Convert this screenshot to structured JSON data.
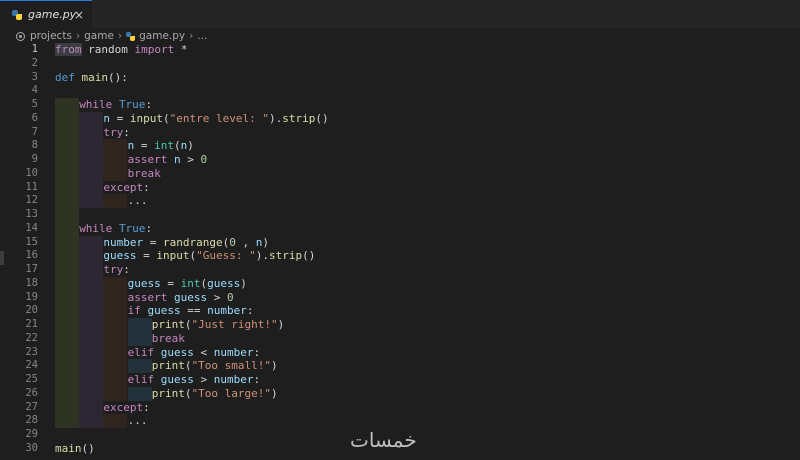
{
  "tab": {
    "filename": "game.py",
    "close_glyph": "×"
  },
  "breadcrumb": {
    "items": [
      "projects",
      "game",
      "game.py",
      "..."
    ]
  },
  "watermark": "خمسات",
  "colors": {
    "keyword_flow": "#c586c0",
    "keyword": "#569cd6",
    "function": "#dcdcaa",
    "string": "#ce9178",
    "number": "#b5cea8",
    "variable": "#9cdcfe",
    "text": "#d4d4d4"
  },
  "editor": {
    "active_line": 1,
    "lines": [
      {
        "n": "1",
        "i": 0,
        "t": [
          [
            "from",
            "kw-flow from-hl"
          ],
          [
            " random ",
            "plain"
          ],
          [
            "import",
            "kw-flow"
          ],
          [
            " *",
            "plain"
          ]
        ]
      },
      {
        "n": "2",
        "i": 0,
        "t": []
      },
      {
        "n": "3",
        "i": 0,
        "t": [
          [
            "def",
            "kw"
          ],
          [
            " ",
            "plain"
          ],
          [
            "main",
            "fn"
          ],
          [
            "():",
            "plain"
          ]
        ]
      },
      {
        "n": "4",
        "i": 0,
        "t": []
      },
      {
        "n": "5",
        "i": 1,
        "t": [
          [
            "while",
            "kw-flow"
          ],
          [
            " ",
            "plain"
          ],
          [
            "True",
            "kw"
          ],
          [
            ":",
            "plain"
          ]
        ]
      },
      {
        "n": "6",
        "i": 2,
        "t": [
          [
            "n",
            "var"
          ],
          [
            " = ",
            "plain"
          ],
          [
            "input",
            "fn"
          ],
          [
            "(",
            "plain"
          ],
          [
            "\"entre level: \"",
            "str"
          ],
          [
            ").",
            "plain"
          ],
          [
            "strip",
            "fn"
          ],
          [
            "()",
            "plain"
          ]
        ]
      },
      {
        "n": "7",
        "i": 2,
        "t": [
          [
            "try",
            "kw-flow"
          ],
          [
            ":",
            "plain"
          ]
        ]
      },
      {
        "n": "8",
        "i": 3,
        "t": [
          [
            "n",
            "var"
          ],
          [
            " = ",
            "plain"
          ],
          [
            "int",
            "builtin"
          ],
          [
            "(",
            "plain"
          ],
          [
            "n",
            "var"
          ],
          [
            ")",
            "plain"
          ]
        ]
      },
      {
        "n": "9",
        "i": 3,
        "t": [
          [
            "assert",
            "kw-flow"
          ],
          [
            " ",
            "plain"
          ],
          [
            "n",
            "var"
          ],
          [
            " > ",
            "plain"
          ],
          [
            "0",
            "num"
          ]
        ]
      },
      {
        "n": "10",
        "i": 3,
        "t": [
          [
            "break",
            "kw-flow"
          ]
        ]
      },
      {
        "n": "11",
        "i": 2,
        "t": [
          [
            "except",
            "kw-flow"
          ],
          [
            ":",
            "plain"
          ]
        ]
      },
      {
        "n": "12",
        "i": 3,
        "t": [
          [
            "...",
            "plain"
          ]
        ]
      },
      {
        "n": "13",
        "i": 0,
        "t": []
      },
      {
        "n": "14",
        "i": 1,
        "t": [
          [
            "while",
            "kw-flow"
          ],
          [
            " ",
            "plain"
          ],
          [
            "True",
            "kw"
          ],
          [
            ":",
            "plain"
          ]
        ]
      },
      {
        "n": "15",
        "i": 2,
        "t": [
          [
            "number",
            "var"
          ],
          [
            " = ",
            "plain"
          ],
          [
            "randrange",
            "fn"
          ],
          [
            "(",
            "plain"
          ],
          [
            "0",
            "num"
          ],
          [
            " , ",
            "plain"
          ],
          [
            "n",
            "var"
          ],
          [
            ")",
            "plain"
          ]
        ]
      },
      {
        "n": "16",
        "i": 2,
        "t": [
          [
            "guess",
            "var"
          ],
          [
            " = ",
            "plain"
          ],
          [
            "input",
            "fn"
          ],
          [
            "(",
            "plain"
          ],
          [
            "\"Guess: \"",
            "str"
          ],
          [
            ").",
            "plain"
          ],
          [
            "strip",
            "fn"
          ],
          [
            "()",
            "plain"
          ]
        ]
      },
      {
        "n": "17",
        "i": 2,
        "t": [
          [
            "try",
            "kw-flow"
          ],
          [
            ":",
            "plain"
          ]
        ]
      },
      {
        "n": "18",
        "i": 3,
        "t": [
          [
            "guess",
            "var"
          ],
          [
            " = ",
            "plain"
          ],
          [
            "int",
            "builtin"
          ],
          [
            "(",
            "plain"
          ],
          [
            "guess",
            "var"
          ],
          [
            ")",
            "plain"
          ]
        ]
      },
      {
        "n": "19",
        "i": 3,
        "t": [
          [
            "assert",
            "kw-flow"
          ],
          [
            " ",
            "plain"
          ],
          [
            "guess",
            "var"
          ],
          [
            " > ",
            "plain"
          ],
          [
            "0",
            "num"
          ]
        ]
      },
      {
        "n": "20",
        "i": 3,
        "t": [
          [
            "if",
            "kw-flow"
          ],
          [
            " ",
            "plain"
          ],
          [
            "guess",
            "var"
          ],
          [
            " == ",
            "plain"
          ],
          [
            "number",
            "var"
          ],
          [
            ":",
            "plain"
          ]
        ]
      },
      {
        "n": "21",
        "i": 4,
        "t": [
          [
            "print",
            "fn"
          ],
          [
            "(",
            "plain"
          ],
          [
            "\"Just right!\"",
            "str"
          ],
          [
            ")",
            "plain"
          ]
        ]
      },
      {
        "n": "22",
        "i": 4,
        "t": [
          [
            "break",
            "kw-flow"
          ]
        ]
      },
      {
        "n": "23",
        "i": 3,
        "t": [
          [
            "elif",
            "kw-flow"
          ],
          [
            " ",
            "plain"
          ],
          [
            "guess",
            "var"
          ],
          [
            " < ",
            "plain"
          ],
          [
            "number",
            "var"
          ],
          [
            ":",
            "plain"
          ]
        ]
      },
      {
        "n": "24",
        "i": 4,
        "t": [
          [
            "print",
            "fn"
          ],
          [
            "(",
            "plain"
          ],
          [
            "\"Too small!\"",
            "str"
          ],
          [
            ")",
            "plain"
          ]
        ]
      },
      {
        "n": "25",
        "i": 3,
        "t": [
          [
            "elif",
            "kw-flow"
          ],
          [
            " ",
            "plain"
          ],
          [
            "guess",
            "var"
          ],
          [
            " > ",
            "plain"
          ],
          [
            "number",
            "var"
          ],
          [
            ":",
            "plain"
          ]
        ]
      },
      {
        "n": "26",
        "i": 4,
        "t": [
          [
            "print",
            "fn"
          ],
          [
            "(",
            "plain"
          ],
          [
            "\"Too large!\"",
            "str"
          ],
          [
            ")",
            "plain"
          ]
        ]
      },
      {
        "n": "27",
        "i": 2,
        "t": [
          [
            "except",
            "kw-flow"
          ],
          [
            ":",
            "plain"
          ]
        ]
      },
      {
        "n": "28",
        "i": 3,
        "t": [
          [
            "...",
            "plain"
          ]
        ]
      },
      {
        "n": "29",
        "i": 0,
        "t": []
      },
      {
        "n": "30",
        "i": 0,
        "t": [
          [
            "main",
            "fn"
          ],
          [
            "()",
            "plain"
          ]
        ]
      }
    ]
  }
}
